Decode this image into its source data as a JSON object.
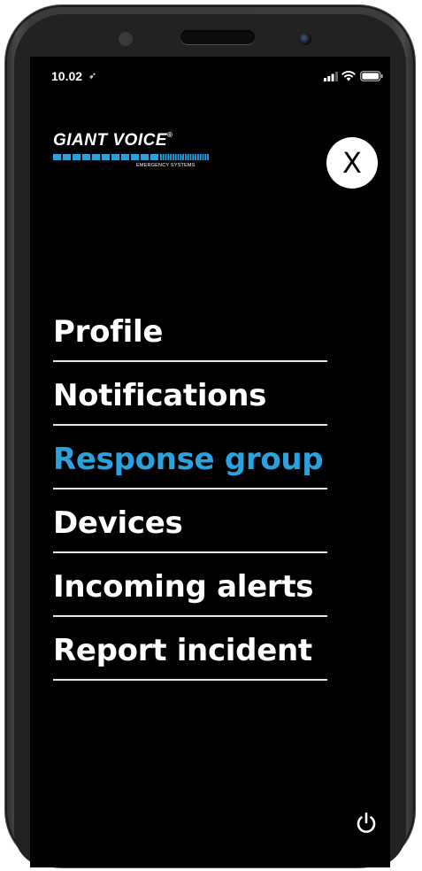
{
  "status_bar": {
    "time": "10.02",
    "location_glyph": "➶",
    "icons": [
      "signal-icon",
      "wifi-icon",
      "battery-icon"
    ]
  },
  "brand": {
    "name": "GIANT VOICE",
    "registered": "®",
    "tagline": "EMERGENCY SYSTEMS",
    "accent_color": "#29a3e0"
  },
  "close_button": {
    "label": "X"
  },
  "menu": {
    "items": [
      {
        "label": "Profile",
        "active": false
      },
      {
        "label": "Notifications",
        "active": false
      },
      {
        "label": "Response group",
        "active": true
      },
      {
        "label": "Devices",
        "active": false
      },
      {
        "label": "Incoming alerts",
        "active": false
      },
      {
        "label": "Report incident",
        "active": false
      }
    ],
    "active_color": "#29a3e0",
    "text_color": "#ffffff"
  },
  "footer": {
    "power_icon": "power-icon"
  }
}
